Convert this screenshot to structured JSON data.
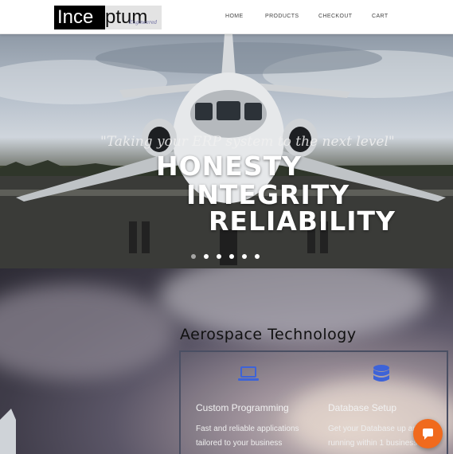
{
  "header": {
    "logo": {
      "part1": "Ince",
      "part2": "ptum",
      "tagline": "Engineered"
    },
    "nav": [
      {
        "label": "HOME"
      },
      {
        "label": "PRODUCTS"
      },
      {
        "label": "CHECKOUT"
      },
      {
        "label": "CART"
      }
    ]
  },
  "hero": {
    "quote": "\"Taking your ERP system to the next level\"",
    "lines": [
      "HONESTY",
      "INTEGRITY",
      "RELIABILITY"
    ],
    "slides": {
      "count": 6,
      "active": 1
    }
  },
  "section": {
    "title": "Aerospace Technology",
    "services": [
      {
        "icon": "laptop-icon",
        "title": "Custom Programming",
        "text": [
          "Fast and reliable applications",
          "tailored to your business"
        ]
      },
      {
        "icon": "database-icon",
        "title": "Database Setup",
        "text": [
          "Get your Database up and",
          "running within 1 business"
        ]
      }
    ]
  },
  "chat": {
    "icon": "chat-icon"
  },
  "colors": {
    "accent": "#f06a1d",
    "icon_blue": "#3d63d8",
    "panel_border": "#4a4f63"
  }
}
